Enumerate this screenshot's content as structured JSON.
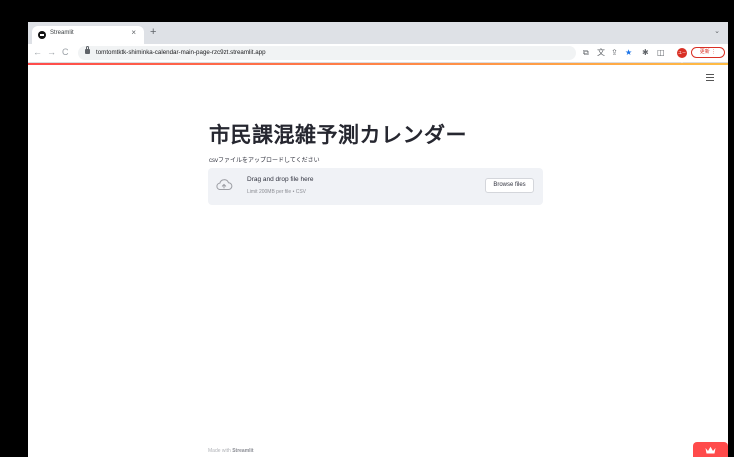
{
  "browser": {
    "tab": {
      "title": "Streamlit",
      "close": "×"
    },
    "new_tab": "+",
    "tab_menu": "⌄",
    "nav": {
      "back": "←",
      "forward": "→",
      "reload": "C"
    },
    "url": "tomtomtktk-shiminka-calendar-main-page-rzc9zt.streamlit.app",
    "toolbar_icons": [
      "share-window-icon",
      "translate-icon",
      "share-icon",
      "bookmark-star-icon",
      "extensions-icon",
      "sidepanel-icon"
    ],
    "profile_label": "ユーザ",
    "update_label": "更新 ⋮",
    "accent": "#ff4b4b"
  },
  "app": {
    "title": "市民課混雑予測カレンダー",
    "uploader": {
      "label": "csvファイルをアップロードしてください",
      "drop_text": "Drag and drop file here",
      "limit_text": "Limit 200MB per file • CSV",
      "browse_label": "Browse files"
    },
    "footer": {
      "prefix": "Made with",
      "brand": "Streamlit"
    }
  }
}
